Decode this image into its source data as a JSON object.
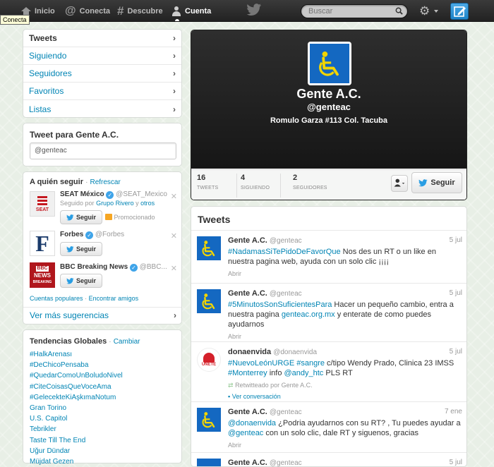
{
  "topbar": {
    "nav": {
      "home": "Inicio",
      "connect": "Conecta",
      "discover": "Descubre",
      "account": "Cuenta"
    },
    "search_placeholder": "Buscar",
    "tooltip": "Conecta"
  },
  "sidebar": {
    "menu": [
      "Tweets",
      "Siguiendo",
      "Seguidores",
      "Favoritos",
      "Listas"
    ],
    "tweet_box": {
      "title": "Tweet para Gente A.C.",
      "value": "@genteac"
    },
    "who_to_follow": {
      "title": "A quién seguir",
      "refresh": "Refrescar",
      "users": [
        {
          "name": "SEAT México",
          "handle": "@SEAT_Mexico",
          "followed_by_prefix": "Seguido por",
          "followed_by": "Grupo Rivero",
          "and": "y",
          "others": "otros",
          "button": "Seguir",
          "promoted": "Promocionado",
          "avatar_label": "SEAT"
        },
        {
          "name": "Forbes",
          "handle": "@Forbes",
          "button": "Seguir",
          "avatar_label": "F"
        },
        {
          "name": "BBC Breaking News",
          "handle": "@BBC...",
          "button": "Seguir",
          "avatar_label_1": "BBC",
          "avatar_label_2": "NEWS",
          "avatar_label_3": "BREAKING"
        }
      ],
      "links": [
        "Cuentas populares",
        "Encontrar amigos"
      ],
      "more": "Ver más sugerencias"
    },
    "trends": {
      "title": "Tendencias Globales",
      "change": "Cambiar",
      "items": [
        "#HalkArenası",
        "#DeChicoPensaba",
        "#QuedarComoUnBoludoNivel",
        "#CiteCoisasQueVoceAma",
        "#GelecekteKiAşkımaNotum",
        "Gran Torino",
        "U.S. Capitol",
        "Tebrikler",
        "Taste Till The End",
        "Uğur Dündar",
        "Müjdat Gezen"
      ]
    }
  },
  "profile": {
    "name": "Gente A.C.",
    "handle": "@genteac",
    "location": "Romulo Garza #113 Col. Tacuba",
    "stats": [
      {
        "value": "16",
        "label": "TWEETS"
      },
      {
        "value": "4",
        "label": "SIGUIENDO"
      },
      {
        "value": "2",
        "label": "SEGUIDORES"
      }
    ],
    "follow_button": "Seguir"
  },
  "tweets": {
    "title": "Tweets",
    "items": [
      {
        "name": "Gente A.C.",
        "handle": "@genteac",
        "date": "5 jul",
        "hashtag": "#NadamasSiTePidoDeFavorQue",
        "text": " Nos des un RT o un like en nuestra pagina web, ayuda con un solo clic ¡¡¡¡",
        "action": "Abrir"
      },
      {
        "name": "Gente A.C.",
        "handle": "@genteac",
        "date": "5 jul",
        "hashtag": "#5MinutosSonSuficientesPara",
        "text": " Hacer un pequeño cambio, entra a nuestra pagina ",
        "link": "genteac.org.mx",
        "text2": " y enterate de como puedes ayudarnos",
        "action": "Abrir"
      },
      {
        "name": "donaenvida",
        "handle": "@donaenvida",
        "date": "5 jul",
        "hashtag": "#NuevoLeónURGE",
        "hashtag2": "#sangre",
        "text": " c/tipo Wendy Prado, Clinica 23 IMSS",
        "hashtag3": "#Monterrey",
        "text2": " info ",
        "mention": "@andy_htc",
        "text3": " PLS RT",
        "retweeted": "Retwitteado por Gente A.C.",
        "action": "Ver conversación",
        "avatar_label": "ÚNETE"
      },
      {
        "name": "Gente A.C.",
        "handle": "@genteac",
        "date": "7 ene",
        "mention": "@donaenvida",
        "text": " ¿Podria ayudarnos con su RT? , Tu puedes ayudar a ",
        "mention2": "@genteac",
        "text2": " con un solo clic, dale RT y siguenos, gracias",
        "action": "Abrir"
      },
      {
        "name": "Gente A.C.",
        "handle": "@genteac",
        "date": "5 jul"
      }
    ]
  },
  "colors": {
    "link": "#0084b4",
    "brand_blue": "#1468c1",
    "topbar": "#2b2b2b"
  }
}
